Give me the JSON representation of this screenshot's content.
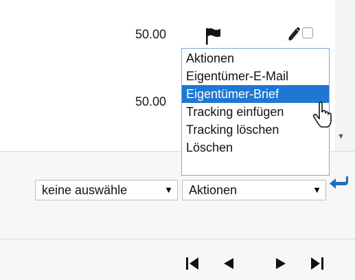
{
  "rows": [
    {
      "amount": "50.00"
    },
    {
      "amount": "50.00"
    }
  ],
  "dropdown": {
    "items": [
      {
        "label": "Aktionen",
        "selected": false
      },
      {
        "label": "Eigentümer-E-Mail",
        "selected": false
      },
      {
        "label": "Eigentümer-Brief",
        "selected": true
      },
      {
        "label": "Tracking einfügen",
        "selected": false
      },
      {
        "label": "Tracking löschen",
        "selected": false
      },
      {
        "label": "Löschen",
        "selected": false
      }
    ]
  },
  "selection_select": {
    "value": "keine auswähle"
  },
  "action_select": {
    "value": "Aktionen"
  },
  "icons": {
    "flag": "flag-icon",
    "edit": "pencil-icon",
    "apply": "return-arrow-icon",
    "first": "first-page-icon",
    "prev": "previous-page-icon",
    "next": "next-page-icon",
    "last": "last-page-icon"
  },
  "colors": {
    "highlight": "#1e77d3",
    "dropdown_border": "#7aa7d8",
    "apply_icon": "#1f6fbf"
  }
}
